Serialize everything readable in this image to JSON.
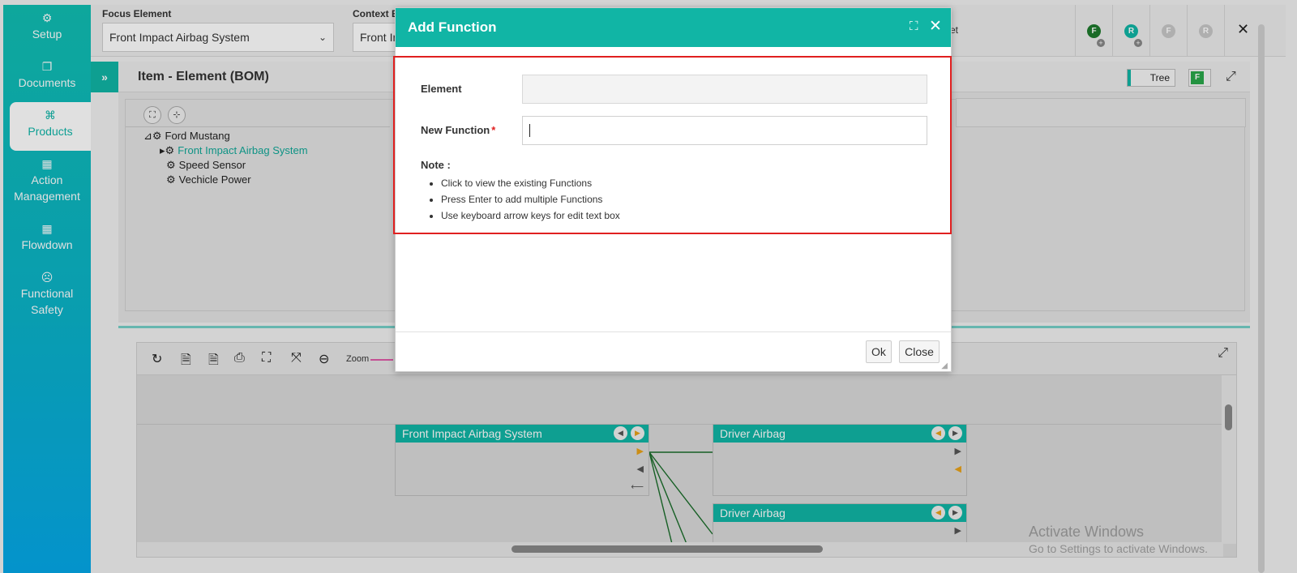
{
  "sidebar": {
    "items": [
      {
        "label": "Setup",
        "icon": "gears-icon"
      },
      {
        "label": "Documents",
        "icon": "documents-icon"
      },
      {
        "label": "Products",
        "icon": "products-icon",
        "active": true
      },
      {
        "label": "Action Management",
        "icon": "building-icon"
      },
      {
        "label": "Flowdown",
        "icon": "building-icon"
      },
      {
        "label": "Functional Safety",
        "icon": "safety-icon"
      }
    ]
  },
  "topbar": {
    "focus_label": "Focus Element",
    "focus_value": "Front Impact Airbag System",
    "context_label": "Context E",
    "context_value": "Front In",
    "partial_text": "et",
    "buttons": [
      {
        "letter": "F",
        "color": "#1e7a2d"
      },
      {
        "letter": "R",
        "color": "#11b5a5"
      },
      {
        "letter": "F",
        "color": "#c8c8c8"
      },
      {
        "letter": "R",
        "color": "#c8c8c8"
      }
    ]
  },
  "item_panel": {
    "title": "Item - Element (BOM)",
    "tree_toggle": "Tree",
    "f_toggle": "F",
    "tree": [
      {
        "label": "Ford Mustang",
        "level": 0
      },
      {
        "label": "Front Impact Airbag System",
        "level": 1,
        "selected": true
      },
      {
        "label": "Speed Sensor",
        "level": 1
      },
      {
        "label": "Vechicle Power",
        "level": 1
      }
    ]
  },
  "diagram": {
    "zoom_label": "Zoom",
    "boxes": [
      {
        "title": "Front Impact Airbag System"
      },
      {
        "title": "Driver Airbag"
      },
      {
        "title": "Driver Airbag"
      }
    ]
  },
  "modal": {
    "title": "Add Function",
    "element_label": "Element",
    "element_value": "",
    "new_function_label": "New Function",
    "required_mark": "*",
    "new_function_value": "",
    "note_title": "Note :",
    "notes": [
      "Click to view the existing Functions",
      "Press Enter to add multiple Functions",
      "Use keyboard arrow keys for edit text box"
    ],
    "ok_label": "Ok",
    "close_label": "Close"
  },
  "watermark": {
    "line1": "Activate Windows",
    "line2": "Go to Settings to activate Windows."
  },
  "colors": {
    "accent": "#11b5a5",
    "required": "#e02020",
    "highlight_border": "#e02020"
  }
}
